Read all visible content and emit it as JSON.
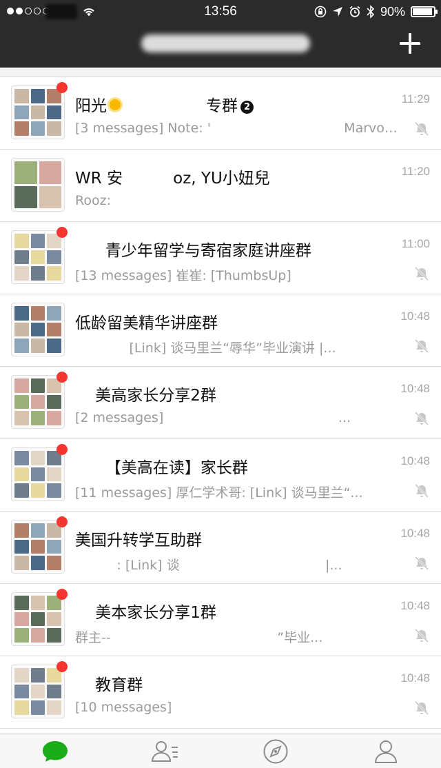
{
  "status_bar": {
    "time": "13:56",
    "battery": "90%",
    "battery_level": 0.9,
    "signal_dots_filled": 2,
    "signal_dots_total": 5
  },
  "header": {
    "title": "",
    "add_icon": "plus-icon",
    "background": "#2b2b2b"
  },
  "chats": [
    {
      "name_parts": [
        "阳光",
        "sun-emoji",
        "",
        "专群"
      ],
      "name_badge": "2",
      "time": "11:29",
      "preview": "[3 messages] Note: '                                Marvolo\" i...",
      "muted": true,
      "unread_dot": true,
      "avatar_layout": "3x3"
    },
    {
      "name": "WR 安          oz, YU小妞兒",
      "time": "11:20",
      "preview": "Rooz:",
      "muted": false,
      "unread_dot": false,
      "avatar_layout": "2x2"
    },
    {
      "name": "      青少年留学与寄宿家庭讲座群",
      "time": "11:00",
      "preview": "[13 messages] 崔崔: [ThumbsUp]",
      "muted": true,
      "unread_dot": true,
      "avatar_layout": "3x3"
    },
    {
      "name": "低龄留美精华讲座群",
      "time": "10:48",
      "preview": "             [Link] 谈马里兰“辱华”毕业演讲 |...",
      "muted": true,
      "unread_dot": false,
      "avatar_layout": "3x3"
    },
    {
      "name": "    美高家长分享2群",
      "time": "10:48",
      "preview": "[2 messages]                                          ...",
      "muted": true,
      "unread_dot": true,
      "avatar_layout": "3x3"
    },
    {
      "name": "      【美高在读】家长群",
      "time": "10:48",
      "preview": "[11 messages] 厚仁学术哥: [Link] 谈马里兰“...",
      "muted": true,
      "unread_dot": true,
      "avatar_layout": "3x3"
    },
    {
      "name": "美国升转学互助群",
      "time": "10:48",
      "preview": "          : [Link] 谈                                   |...",
      "muted": true,
      "unread_dot": true,
      "avatar_layout": "3x3"
    },
    {
      "name": "    美本家长分享1群",
      "time": "10:48",
      "preview": "群主--                                        ”毕业...",
      "muted": true,
      "unread_dot": true,
      "avatar_layout": "3x3"
    },
    {
      "name": "    教育群",
      "time": "10:48",
      "preview": "[10 messages]",
      "muted": true,
      "unread_dot": true,
      "avatar_layout": "3x3"
    }
  ],
  "tabs": [
    {
      "icon": "chat-bubble-icon",
      "active": true
    },
    {
      "icon": "contacts-icon",
      "active": false
    },
    {
      "icon": "compass-icon",
      "active": false
    },
    {
      "icon": "profile-icon",
      "active": false
    }
  ],
  "colors": {
    "accent": "#1aad19",
    "unread_dot": "#f43530",
    "muted_gray": "#a6a6a6"
  }
}
